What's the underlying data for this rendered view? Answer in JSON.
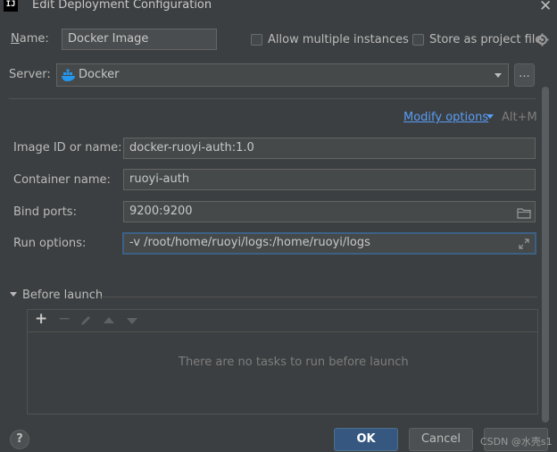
{
  "window": {
    "title": "Edit Deployment Configuration",
    "app_icon_text": "IJ"
  },
  "name_row": {
    "label": "Name:",
    "value": "Docker Image",
    "allow_multiple_label": "Allow multiple instances",
    "store_as_project_label": "Store as project file"
  },
  "server_row": {
    "label": "Server:",
    "selected": "Docker",
    "browse_label": "..."
  },
  "modify_options": {
    "label": "Modify options",
    "shortcut": "Alt+M"
  },
  "fields": {
    "image_id": {
      "label": "Image ID or name:",
      "value": "docker-ruoyi-auth:1.0"
    },
    "container_name": {
      "label": "Container name:",
      "value": "ruoyi-auth"
    },
    "bind_ports": {
      "label": "Bind ports:",
      "value": "9200:9200"
    },
    "run_options": {
      "label": "Run options:",
      "value": "-v /root/home/ruoyi/logs:/home/ruoyi/logs"
    }
  },
  "before_launch": {
    "label": "Before launch",
    "empty_text": "There are no tasks to run before launch"
  },
  "buttons": {
    "ok": "OK",
    "cancel": "Cancel",
    "help": "?"
  },
  "watermark": "CSDN @水壳s1",
  "colors": {
    "accent": "#589df6",
    "ok_button": "#365880",
    "background": "#3c3f41",
    "docker_blue": "#2496ed"
  }
}
